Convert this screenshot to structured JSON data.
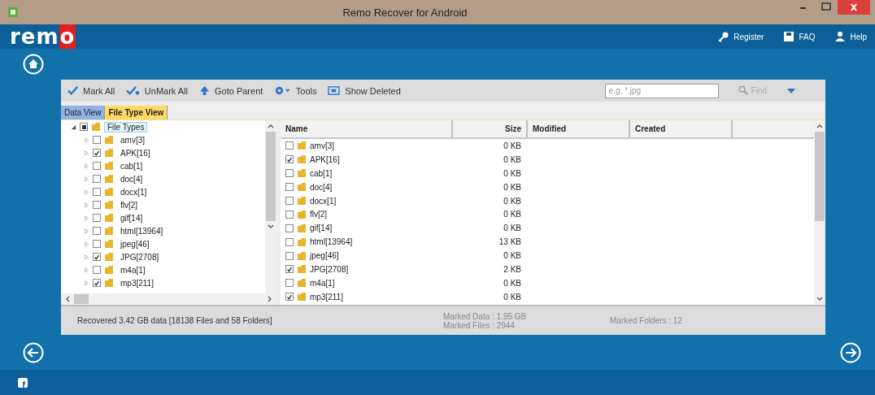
{
  "window": {
    "title": "Remo Recover for Android"
  },
  "header": {
    "logo": "remo",
    "links": [
      {
        "kind": "register",
        "label": "Register"
      },
      {
        "kind": "faq",
        "label": "FAQ"
      },
      {
        "kind": "help",
        "label": "Help"
      }
    ]
  },
  "toolbar": {
    "buttons": [
      {
        "kind": "mark",
        "label": "Mark All"
      },
      {
        "kind": "unmark",
        "label": "UnMark All"
      },
      {
        "kind": "parent",
        "label": "Goto Parent"
      },
      {
        "kind": "tools",
        "label": "Tools"
      },
      {
        "kind": "deleted",
        "label": "Show Deleted"
      }
    ],
    "search": {
      "placeholder": "e.g. *.jpg"
    },
    "find": {
      "label": "Find",
      "disabled": true
    }
  },
  "tabs": [
    {
      "label": "Data View",
      "selected": false
    },
    {
      "label": "File Type View",
      "selected": true
    }
  ],
  "tree": {
    "label": "File Types",
    "selected": true,
    "expanded": true,
    "partial": true,
    "children": [
      {
        "label": "amv[3]",
        "checked": false,
        "selected": false
      },
      {
        "label": "APK[16]",
        "checked": true,
        "selected": false
      },
      {
        "label": "cab[1]",
        "checked": false,
        "selected": false
      },
      {
        "label": "doc[4]",
        "checked": false,
        "selected": false
      },
      {
        "label": "docx[1]",
        "checked": false,
        "selected": false
      },
      {
        "label": "flv[2]",
        "checked": false,
        "selected": false
      },
      {
        "label": "gif[14]",
        "checked": false,
        "selected": false
      },
      {
        "label": "html[13964]",
        "checked": false,
        "selected": false
      },
      {
        "label": "jpeg[46]",
        "checked": false,
        "selected": false
      },
      {
        "label": "JPG[2708]",
        "checked": true,
        "selected": false
      },
      {
        "label": "m4a[1]",
        "checked": false,
        "selected": false
      },
      {
        "label": "mp3[211]",
        "checked": true,
        "selected": false
      }
    ]
  },
  "table": {
    "columns": [
      "Name",
      "Size",
      "Modified",
      "Created"
    ],
    "rows": [
      {
        "name": "amv[3]",
        "size": "0 KB",
        "checked": false
      },
      {
        "name": "APK[16]",
        "size": "0 KB",
        "checked": true
      },
      {
        "name": "cab[1]",
        "size": "0 KB",
        "checked": false
      },
      {
        "name": "doc[4]",
        "size": "0 KB",
        "checked": false
      },
      {
        "name": "docx[1]",
        "size": "0 KB",
        "checked": false
      },
      {
        "name": "flv[2]",
        "size": "0 KB",
        "checked": false
      },
      {
        "name": "gif[14]",
        "size": "0 KB",
        "checked": false
      },
      {
        "name": "html[13964]",
        "size": "13 KB",
        "checked": false
      },
      {
        "name": "jpeg[46]",
        "size": "0 KB",
        "checked": false
      },
      {
        "name": "JPG[2708]",
        "size": "2 KB",
        "checked": true
      },
      {
        "name": "m4a[1]",
        "size": "0 KB",
        "checked": false
      },
      {
        "name": "mp3[211]",
        "size": "0 KB",
        "checked": true
      }
    ]
  },
  "status_bar": {
    "recovered": "Recovered 3.42 GB data [18138 Files and 58 Folders]",
    "marked_data": "Marked Data : 1.95 GB",
    "marked_files": "Marked Files : 2944",
    "marked_folders": "Marked Folders : 12"
  }
}
